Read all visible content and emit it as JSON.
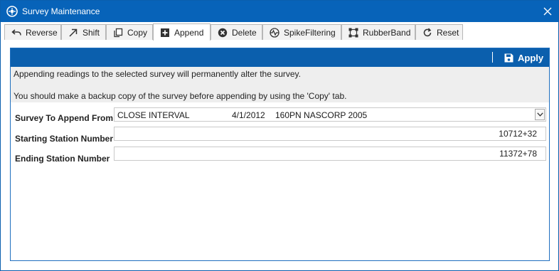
{
  "window": {
    "title": "Survey Maintenance"
  },
  "tabs": [
    {
      "label": "Reverse",
      "icon": "undo-arrow-icon"
    },
    {
      "label": "Shift",
      "icon": "diagonal-arrow-icon"
    },
    {
      "label": "Copy",
      "icon": "copy-icon"
    },
    {
      "label": "Append",
      "icon": "plus-box-icon",
      "active": true
    },
    {
      "label": "Delete",
      "icon": "delete-circle-icon"
    },
    {
      "label": "SpikeFiltering",
      "icon": "spike-filter-icon"
    },
    {
      "label": "RubberBand",
      "icon": "rubberband-icon"
    },
    {
      "label": "Reset",
      "icon": "refresh-icon"
    }
  ],
  "toolbar": {
    "apply_label": "Apply"
  },
  "notice": {
    "line1": "Appending readings to the selected survey will permanently alter the survey.",
    "line2": "You should make a backup copy of the survey before appending by using the 'Copy' tab."
  },
  "form": {
    "survey_label": "Survey To Append From",
    "survey_selected": {
      "type": "CLOSE INTERVAL",
      "date": "4/1/2012",
      "name": "160PN NASCORP 2005"
    },
    "start_label": "Starting Station Number",
    "start_value": "10712+32",
    "end_label": "Ending Station Number",
    "end_value": "11372+78"
  },
  "colors": {
    "titlebar": "#0763b9",
    "accent": "#0b5fad",
    "notice_bg": "#eeeeee"
  }
}
